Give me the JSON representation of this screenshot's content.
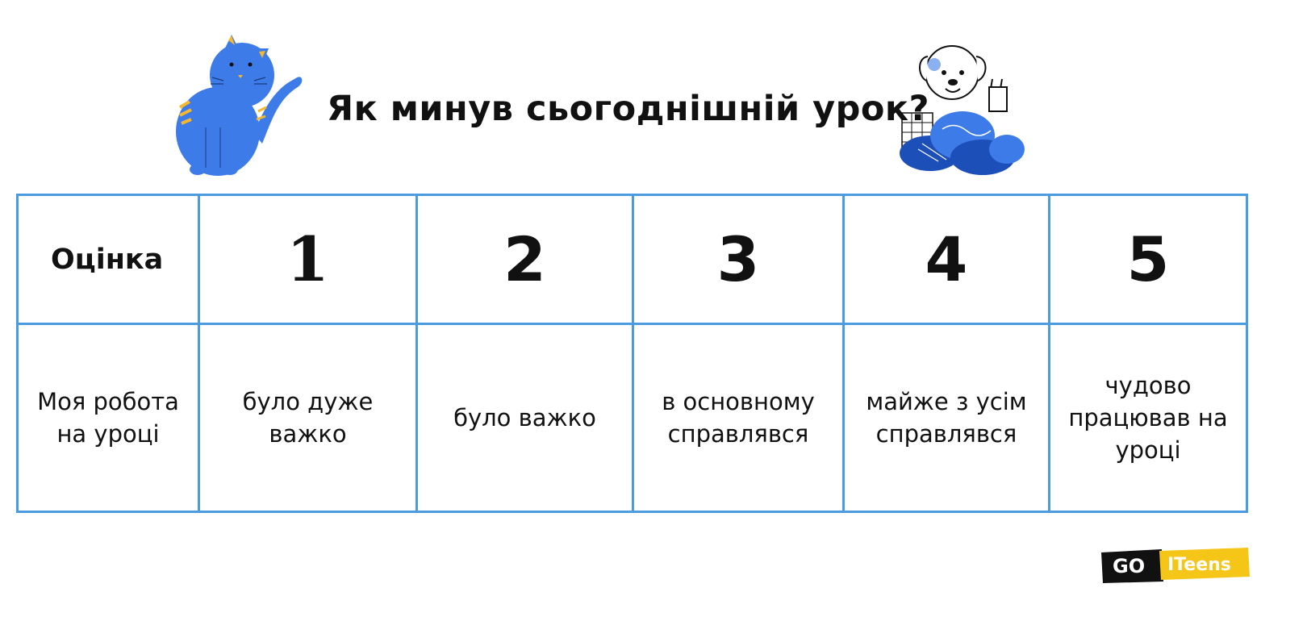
{
  "title": "Як минув сьогоднішній урок?",
  "table": {
    "header_label": "Оцінка",
    "row_label": "Моя робота на уроці",
    "grades": [
      "1",
      "2",
      "3",
      "4",
      "5"
    ],
    "descriptions": [
      "було дуже важко",
      "було важко",
      "в основному справлявся",
      "майже з усім справлявся",
      "чудово працював на уроці"
    ]
  },
  "logo": {
    "left": "GO",
    "right": "ITeens"
  },
  "colors": {
    "border": "#4a9be0",
    "cat": "#3d7be8",
    "stripes": "#f5b82e",
    "logo_black": "#111111",
    "logo_yellow": "#f5c518"
  },
  "icons": [
    "cat-illustration",
    "dog-illustration"
  ]
}
